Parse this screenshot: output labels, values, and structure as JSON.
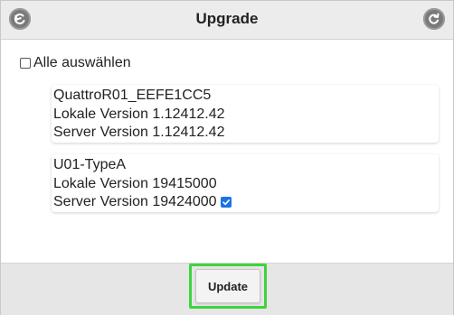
{
  "header": {
    "title": "Upgrade",
    "back_icon": "back-arrow-icon",
    "refresh_icon": "refresh-icon"
  },
  "select_all": {
    "label": "Alle auswählen",
    "checked": false
  },
  "devices": [
    {
      "name": "QuattroR01_EEFE1CC5",
      "local_version": "Lokale Version 1.12412.42",
      "server_version": "Server Version 1.12412.42",
      "checked": false
    },
    {
      "name": "U01-TypeA",
      "local_version": "Lokale Version 19415000",
      "server_version": "Server Version 19424000",
      "checked": true
    }
  ],
  "footer": {
    "update_label": "Update",
    "highlight_color": "#3fd33f"
  },
  "colors": {
    "header_bg": "#ececec",
    "icon_bg": "#7a7a7a",
    "checkbox_checked": "#1a73e8"
  }
}
